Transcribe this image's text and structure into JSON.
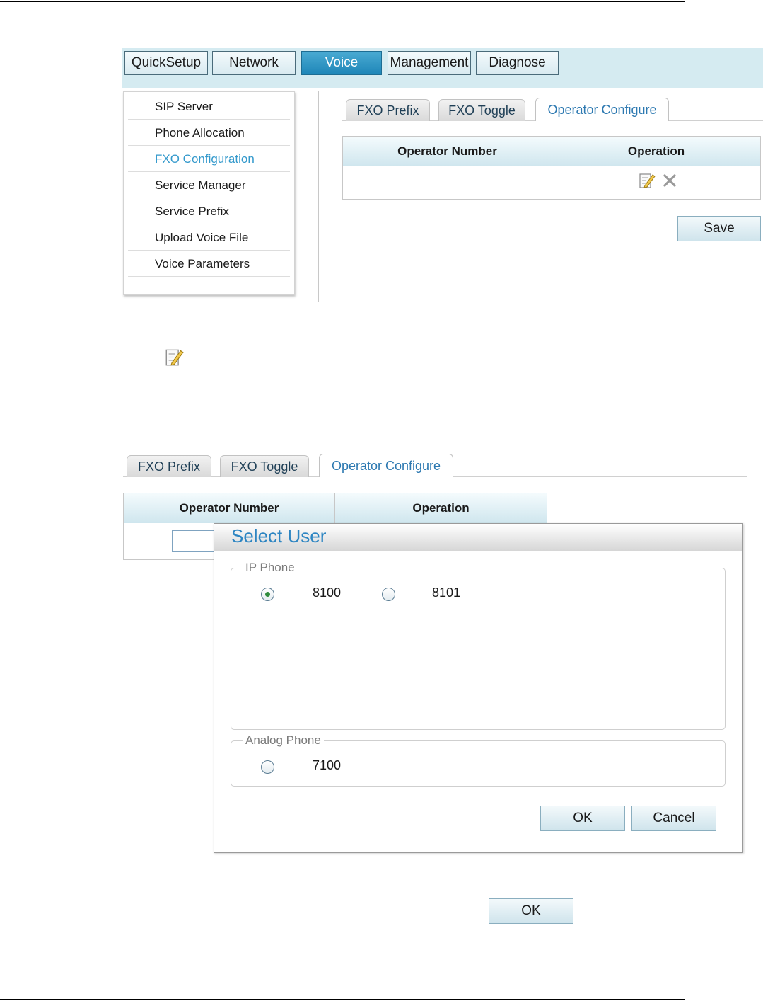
{
  "nav": {
    "items": [
      {
        "label": "QuickSetup",
        "active": false
      },
      {
        "label": "Network",
        "active": false
      },
      {
        "label": "Voice",
        "active": true
      },
      {
        "label": "Management",
        "active": false
      },
      {
        "label": "Diagnose",
        "active": false
      }
    ]
  },
  "sidebar": {
    "items": [
      {
        "label": "SIP Server"
      },
      {
        "label": "Phone Allocation"
      },
      {
        "label": "FXO Configuration",
        "active": true
      },
      {
        "label": "Service Manager"
      },
      {
        "label": "Service Prefix"
      },
      {
        "label": "Upload Voice File"
      },
      {
        "label": "Voice Parameters"
      }
    ]
  },
  "tabs": [
    {
      "label": "FXO Prefix"
    },
    {
      "label": "FXO Toggle"
    },
    {
      "label": "Operator Configure",
      "active": true
    }
  ],
  "table": {
    "headers": [
      "Operator Number",
      "Operation"
    ],
    "operator_number": ""
  },
  "save_label": "Save",
  "dialog": {
    "title": "Select User",
    "ip_phone": {
      "legend": "IP Phone",
      "options": [
        {
          "label": "8100",
          "selected": true
        },
        {
          "label": "8101",
          "selected": false
        }
      ]
    },
    "analog_phone": {
      "legend": "Analog Phone",
      "options": [
        {
          "label": "7100",
          "selected": false
        }
      ]
    },
    "ok_label": "OK",
    "cancel_label": "Cancel"
  },
  "bottom_ok_label": "OK",
  "colors": {
    "nav_active": "#1e86b8",
    "menu_active": "#3399cc",
    "tab_active_text": "#2d79b1",
    "dialog_title": "#2d85c2",
    "radio_selected": "#2e8b3c"
  },
  "icons": {
    "edit": "edit-icon",
    "delete": "delete-icon"
  }
}
